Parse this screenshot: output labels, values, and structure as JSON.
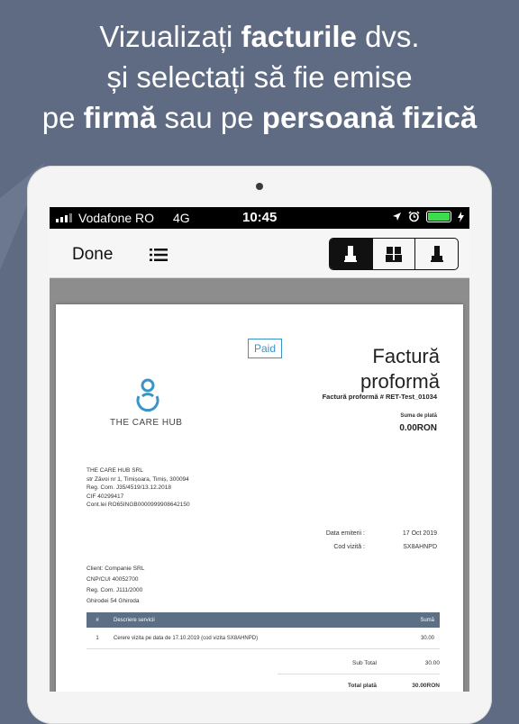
{
  "headline": {
    "line1_a": "Vizualizați  ",
    "line1_b": "facturile",
    "line1_c": " dvs.",
    "line2": "și selectați să fie emise",
    "line3_a": "pe ",
    "line3_b": "firmă",
    "line3_c": " sau pe ",
    "line3_d": "persoană fizică"
  },
  "statusbar": {
    "carrier": "Vodafone RO",
    "network": "4G",
    "time": "10:45",
    "battery_color": "#3ddc4f"
  },
  "toolbar": {
    "done_label": "Done",
    "list_icon": "list-icon",
    "segments": [
      "person-icon",
      "company-icon",
      "person-alt-icon"
    ]
  },
  "invoice": {
    "status": "Paid",
    "title_line1": "Factură",
    "title_line2": "proformă",
    "number": "Factură proformă # RET-Test_01034",
    "amount_label": "Suma de plată",
    "amount_value": "0.00RON",
    "logo_text": "THE CARE HUB",
    "company_lines": [
      "THE CARE HUB SRL",
      "str Zăvoi nr 1, Timișoara, Timiș, 300094",
      "Reg. Com. J35/4519/13.12.2018",
      "CIF 40299417",
      "Cont.lei RO65INGB0000999908642150"
    ],
    "meta": {
      "issue_label": "Data emiterii :",
      "issue_value": "17 Oct 2019",
      "visit_label": "Cod vizită :",
      "visit_value": "SX8AHNPD"
    },
    "client_lines": [
      "Client: Companie SRL",
      "CNP/CUI 40052700",
      "Reg. Com. J111/2000",
      "Ghirodei 54 Ghiroda"
    ],
    "table": {
      "col_num": "#",
      "col_desc": "Descriere servicii",
      "col_sum": "Sumă",
      "rows": [
        {
          "num": "1",
          "desc": "Cerere vizita pe data de 17.10.2019 (cod vizita SX8AHNPD)",
          "sum": "30.00"
        }
      ]
    },
    "subtotal_label": "Sub Total",
    "subtotal_value": "30.00",
    "total_label": "Total plată",
    "total_value": "30.00RON"
  }
}
